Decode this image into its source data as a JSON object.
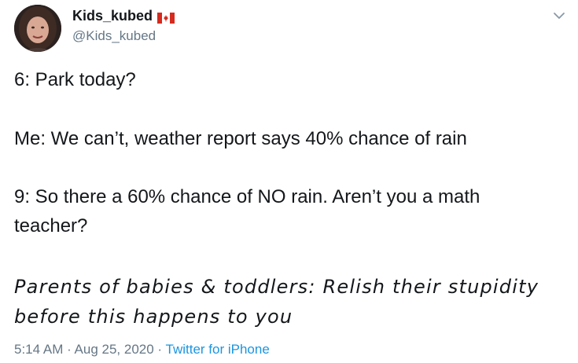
{
  "author": {
    "display_name": "Kids_kubed",
    "handle": "@Kids_kubed",
    "flag_icon": "canada-flag-icon"
  },
  "tweet": {
    "line1": "6: Park today?",
    "line2": "Me: We can’t, weather report says 40% chance of rain",
    "line3": "9: So there a 60% chance of NO rain. Aren’t you a math",
    "line4": "teacher?",
    "quote_line1": "Parents of babies & toddlers: Relish their stupidity",
    "quote_line2": "before this happens to you"
  },
  "meta": {
    "time": "5:14 AM",
    "separator1": " · ",
    "date": "Aug 25, 2020",
    "separator2": " · ",
    "source": "Twitter for iPhone"
  },
  "colors": {
    "text": "#14171a",
    "muted": "#657786",
    "link": "#1b95e0",
    "flag_red": "#d52b1e"
  }
}
